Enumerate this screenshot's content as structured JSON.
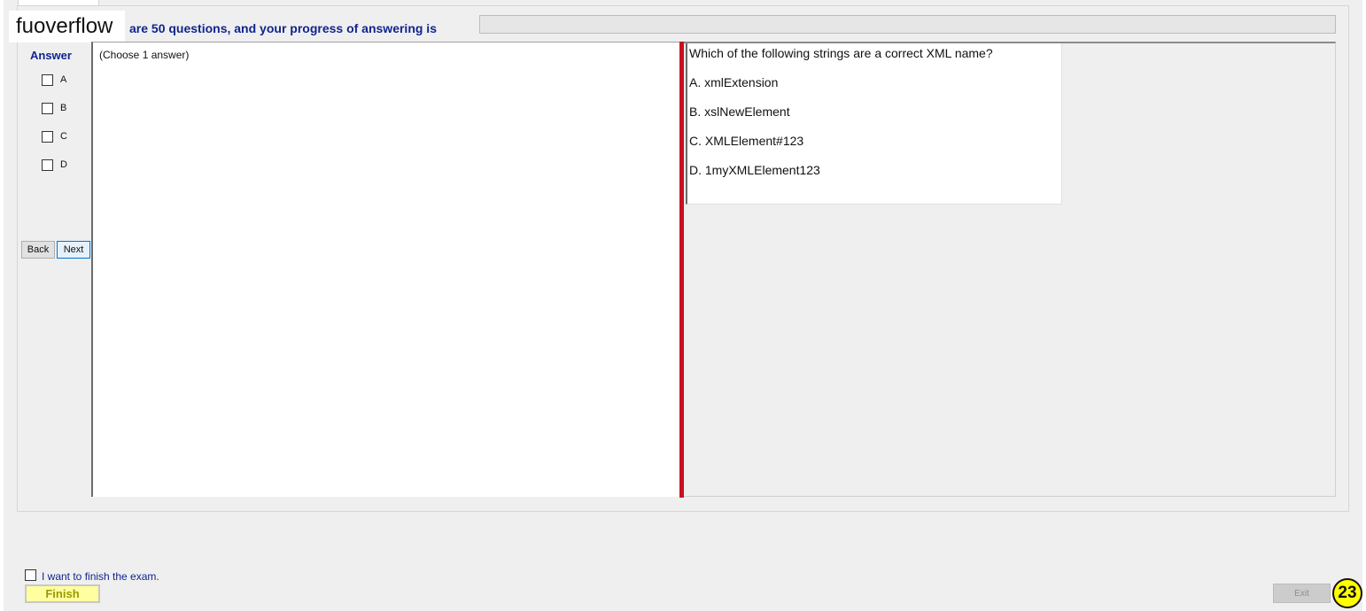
{
  "watermark": "fuoverflow",
  "header": {
    "progress_text": "are 50 questions, and your progress of answering is",
    "progress_fraction": 0
  },
  "answer_panel": {
    "title": "Answer",
    "options": [
      "A",
      "B",
      "C",
      "D"
    ],
    "back_label": "Back",
    "next_label": "Next"
  },
  "left_pane": {
    "instruction": "(Choose 1 answer)"
  },
  "question": {
    "text": "Which of the following strings are a correct XML name?",
    "choices": [
      "A.  xmlExtension",
      "B.  xslNewElement",
      "C.  XMLElement#123",
      "D.  1myXMLElement123"
    ]
  },
  "footer": {
    "finish_check_label": "I want to finish the exam.",
    "finish_label": "Finish",
    "exit_label": "Exit",
    "page_number": "23"
  },
  "colors": {
    "accent_blue": "#10258f",
    "splitter_red": "#c8101e",
    "finish_yellow": "#ffffa0",
    "badge_yellow": "#ffff00"
  }
}
